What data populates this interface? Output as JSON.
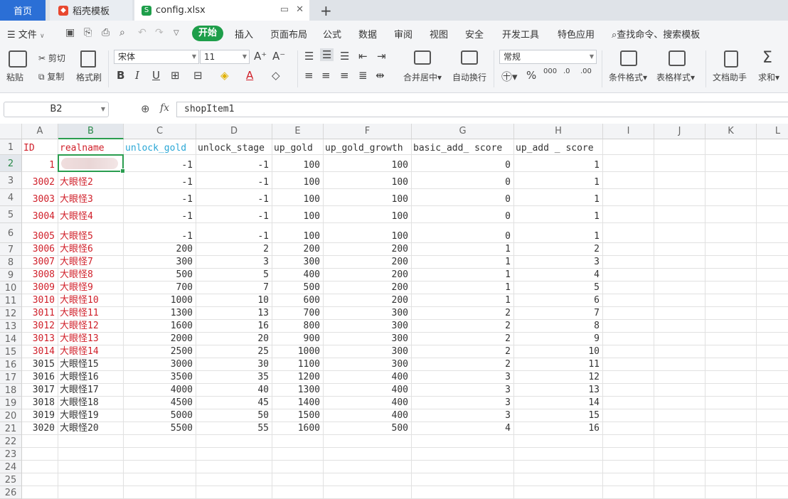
{
  "tabs": [
    {
      "label": "首页"
    },
    {
      "label": "稻壳模板"
    },
    {
      "label": "config.xlsx"
    }
  ],
  "menu": {
    "file": "文件",
    "start": "开始",
    "items": [
      "插入",
      "页面布局",
      "公式",
      "数据",
      "审阅",
      "视图",
      "安全",
      "开发工具",
      "特色应用"
    ],
    "search": "查找命令、搜索模板"
  },
  "ribbon": {
    "paste": "粘贴",
    "cut": "剪切",
    "copy": "复制",
    "format_painter": "格式刷",
    "font_name": "宋体",
    "font_size": "11",
    "merge_center": "合并居中",
    "auto_wrap": "自动换行",
    "number_format": "常规",
    "cond_format": "条件格式",
    "table_style": "表格样式",
    "doc_helper": "文档助手",
    "sum": "求和",
    "bold": "B",
    "italic": "I",
    "underline": "U"
  },
  "formula_bar": {
    "name_box": "B2",
    "fx_label": "fx",
    "content": "shopItem1"
  },
  "sheet": {
    "columns": [
      "A",
      "B",
      "C",
      "D",
      "E",
      "F",
      "G",
      "H",
      "I",
      "J",
      "K",
      "L"
    ],
    "header": [
      "ID",
      "realname",
      "unlock_gold",
      "unlock_stage",
      "up_gold",
      "up_gold_growth",
      "basic_add_ score",
      "up_add _ score"
    ],
    "rows": [
      [
        "1",
        "",
        "-1",
        "-1",
        "100",
        "100",
        "0",
        "1"
      ],
      [
        "3002",
        "大眼怪2",
        "-1",
        "-1",
        "100",
        "100",
        "0",
        "1"
      ],
      [
        "3003",
        "大眼怪3",
        "-1",
        "-1",
        "100",
        "100",
        "0",
        "1"
      ],
      [
        "3004",
        "大眼怪4",
        "-1",
        "-1",
        "100",
        "100",
        "0",
        "1"
      ],
      [
        "3005",
        "大眼怪5",
        "-1",
        "-1",
        "100",
        "100",
        "0",
        "1"
      ],
      [
        "3006",
        "大眼怪6",
        "200",
        "2",
        "200",
        "200",
        "1",
        "2"
      ],
      [
        "3007",
        "大眼怪7",
        "300",
        "3",
        "300",
        "200",
        "1",
        "3"
      ],
      [
        "3008",
        "大眼怪8",
        "500",
        "5",
        "400",
        "200",
        "1",
        "4"
      ],
      [
        "3009",
        "大眼怪9",
        "700",
        "7",
        "500",
        "200",
        "1",
        "5"
      ],
      [
        "3010",
        "大眼怪10",
        "1000",
        "10",
        "600",
        "200",
        "1",
        "6"
      ],
      [
        "3011",
        "大眼怪11",
        "1300",
        "13",
        "700",
        "300",
        "2",
        "7"
      ],
      [
        "3012",
        "大眼怪12",
        "1600",
        "16",
        "800",
        "300",
        "2",
        "8"
      ],
      [
        "3013",
        "大眼怪13",
        "2000",
        "20",
        "900",
        "300",
        "2",
        "9"
      ],
      [
        "3014",
        "大眼怪14",
        "2500",
        "25",
        "1000",
        "300",
        "2",
        "10"
      ],
      [
        "3015",
        "大眼怪15",
        "3000",
        "30",
        "1100",
        "300",
        "2",
        "11"
      ],
      [
        "3016",
        "大眼怪16",
        "3500",
        "35",
        "1200",
        "400",
        "3",
        "12"
      ],
      [
        "3017",
        "大眼怪17",
        "4000",
        "40",
        "1300",
        "400",
        "3",
        "13"
      ],
      [
        "3018",
        "大眼怪18",
        "4500",
        "45",
        "1400",
        "400",
        "3",
        "14"
      ],
      [
        "3019",
        "大眼怪19",
        "5000",
        "50",
        "1500",
        "400",
        "3",
        "15"
      ],
      [
        "3020",
        "大眼怪20",
        "5500",
        "55",
        "1600",
        "500",
        "4",
        "16"
      ]
    ],
    "row_numbers": [
      "1",
      "2",
      "3",
      "4",
      "5",
      "6",
      "7",
      "8",
      "9",
      "10",
      "11",
      "12",
      "13",
      "14",
      "15",
      "16",
      "17",
      "18",
      "19",
      "20",
      "21",
      "22",
      "23",
      "24",
      "25",
      "26"
    ]
  }
}
